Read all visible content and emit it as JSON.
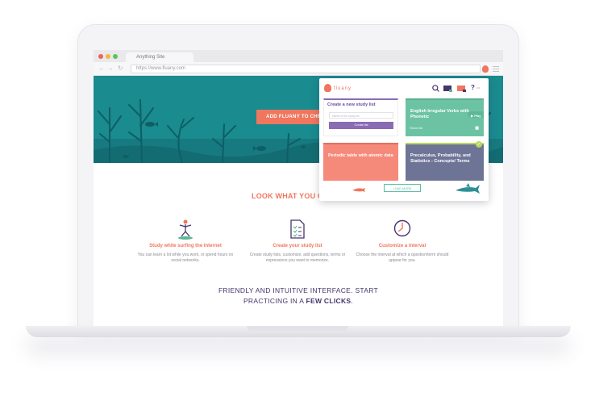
{
  "browser": {
    "tab_title": "Anything Site",
    "url": "https://www.fluany.com"
  },
  "hero": {
    "cta_label": "ADD FLUANY TO CHRO",
    "colors": {
      "sea": "#1a8b8f",
      "coral": "#f0765e"
    }
  },
  "features": {
    "heading": "LOOK WHAT YOU C",
    "items": [
      {
        "icon": "surfer-icon",
        "title": "Study while surfing the Internet",
        "desc": "You can learn a lot while you work, or spend hours on social networks."
      },
      {
        "icon": "checklist-icon",
        "title": "Create your study list",
        "desc": "Create study lists, customize, add questions, terms or expressions you want to memorize."
      },
      {
        "icon": "clock-icon",
        "title": "Customize a interval",
        "desc": "Choose the interval at which a question/term should appear for you."
      }
    ]
  },
  "tagline": {
    "line1": "FRIENDLY AND INTUITIVE INTERFACE. START",
    "line2_prefix": "PRACTICING IN A ",
    "line2_bold": "FEW CLICKS",
    "line2_suffix": "."
  },
  "popup": {
    "brand": "fluany",
    "create": {
      "title": "Create a new study list",
      "placeholder": "Name of the study list",
      "button": "Create list"
    },
    "cards": [
      {
        "title": "English Irregular Verbs with Phonetic",
        "meta": "Show list",
        "play": "Play",
        "color": "#6cc3a3"
      },
      {
        "title": "Periodic table with atomic data",
        "meta": "",
        "play": "",
        "color": "#f5897a"
      },
      {
        "title": "Precalculus, Probability, and Statistics - Concepts/ Terms",
        "meta": "",
        "play": "",
        "color": "#6e7496"
      }
    ],
    "see_more": "LOAD MORE"
  }
}
